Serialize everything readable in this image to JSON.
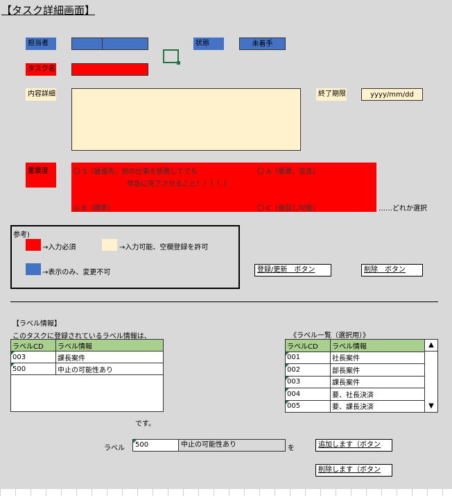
{
  "title": "【タスク詳細画面】",
  "fields": {
    "assignee_label": "担当者",
    "status_label": "状態",
    "status_value": "未着手",
    "taskname_label": "タスク名",
    "detail_label": "内容詳細",
    "due_label": "終了期限",
    "due_placeholder": "yyyy/mm/dd",
    "priority_label": "重要度"
  },
  "priority": {
    "options": [
      {
        "symbol": "〇",
        "label": "S（最優先、他の仕事を放置してでも"
      },
      {
        "symbol": "",
        "label": "早急に完了させること！！！！）"
      },
      {
        "symbol": "〇",
        "label": "A（重要、至急）"
      },
      {
        "symbol": "◎",
        "label": "B（標準）"
      },
      {
        "symbol": "〇",
        "label": "C（後回し可能）"
      }
    ],
    "hint": "……どれか選択"
  },
  "legend": {
    "title": "参考)",
    "required": "→入力必須",
    "optional": "→入力可能、空欄登録を許可",
    "readonly": "→表示のみ、変更不可"
  },
  "buttons": {
    "register": "登録/更新　ボタン",
    "delete": "削除　ボタン",
    "add_label": "追加します（ボタン",
    "remove_label": "削除します（ボタン"
  },
  "labels_section": {
    "heading": "【ラベル情報】",
    "intro": "このタスクに登録されているラベル情報は、",
    "suffix": "です。",
    "columns": [
      "ラベルCD",
      "ラベル情報"
    ],
    "rows": [
      {
        "cd": "003",
        "info": "課長案件"
      },
      {
        "cd": "500",
        "info": "中止の可能性あり"
      }
    ]
  },
  "label_list": {
    "heading": "《ラベル一覧（選択用）》",
    "columns": [
      "ラベルCD",
      "ラベル情報"
    ],
    "rows": [
      {
        "cd": "001",
        "info": "社長案件"
      },
      {
        "cd": "002",
        "info": "部長案件"
      },
      {
        "cd": "003",
        "info": "課長案件"
      },
      {
        "cd": "004",
        "info": "要、社長決済"
      },
      {
        "cd": "005",
        "info": "要、課長決済"
      }
    ],
    "scroll_up": "▲",
    "scroll_down": "▼"
  },
  "label_entry": {
    "label": "ラベル",
    "cd_value": "500",
    "info_value": "中止の可能性あり",
    "particle": "を"
  },
  "colors": {
    "required": "#ff0000",
    "optional": "#fff2cc",
    "readonly": "#4472c4",
    "header_green": "#a9d08e",
    "background": "#d9d9d9"
  }
}
